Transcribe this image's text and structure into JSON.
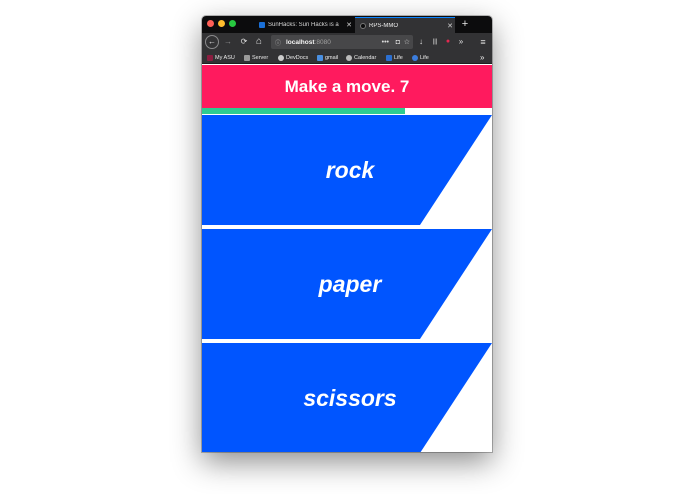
{
  "browser": {
    "tabs": [
      {
        "title": "SunHacks: Sun Hacks is a",
        "favicon_color": "#1a6fd6",
        "active": false
      },
      {
        "title": "RPS-MMO",
        "favicon_color": "#0c0c0d",
        "active": true
      }
    ],
    "url_host": "localhost",
    "url_port": ":8080",
    "bookmarks": [
      {
        "label": "My ASU",
        "icon_color": "#8c1d40"
      },
      {
        "label": "Server",
        "icon_color": "#9a9a9a"
      },
      {
        "label": "DevDocs",
        "icon_color": "#cccccc"
      },
      {
        "label": "gmail",
        "icon_color": "#4a90e2"
      },
      {
        "label": "Calendar",
        "icon_color": "#bbbbbb"
      },
      {
        "label": "Life",
        "icon_color": "#2b6fd1"
      },
      {
        "label": "Life",
        "icon_color": "#3b7ddd"
      }
    ],
    "icons": {
      "back": "←",
      "forward": "→",
      "reload": "⟳",
      "home": "⌂",
      "info": "ⓘ",
      "more": "•••",
      "pocket": "◘",
      "star": "☆",
      "download": "↓",
      "library": "|||",
      "ext": "●",
      "overflow": "»",
      "menu": "≡",
      "new_tab": "+",
      "close": "✕",
      "bookmarks_overflow": "»"
    }
  },
  "game": {
    "header": "Make a move. 7",
    "timer_progress": 0.7,
    "colors": {
      "header_bg": "#ff1a5e",
      "timer": "#2ecc91",
      "choice": "#0055ff"
    },
    "choices": [
      {
        "label": "rock"
      },
      {
        "label": "paper"
      },
      {
        "label": "scissors"
      }
    ]
  }
}
